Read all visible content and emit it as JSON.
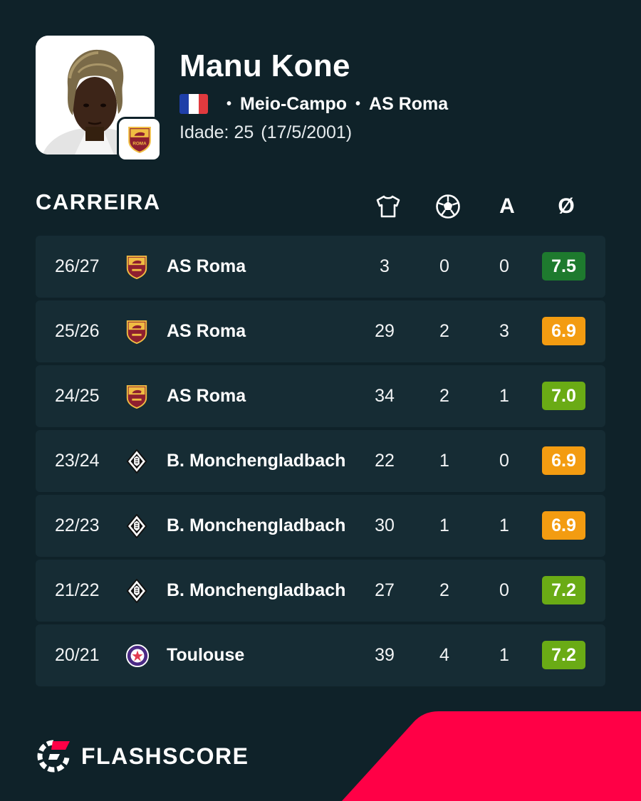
{
  "player": {
    "name": "Manu Kone",
    "nationality_flag": "france-flag",
    "position": "Meio-Campo",
    "club": "AS Roma",
    "age_label": "Idade: 25",
    "birth_date": "(17/5/2001)"
  },
  "career": {
    "title": "CARREIRA",
    "columns": [
      {
        "icon": "shirt-icon",
        "meaning": "appearances"
      },
      {
        "icon": "ball-icon",
        "meaning": "goals"
      },
      {
        "icon": "assists-icon",
        "label": "A"
      },
      {
        "icon": "average-rating-icon",
        "label": "Ø"
      }
    ],
    "rows": [
      {
        "season": "26/27",
        "club": "AS Roma",
        "club_logo": "roma-logo-icon",
        "apps": "3",
        "goals": "0",
        "assists": "0",
        "rating": "7.5",
        "rating_color": "#1e7a2e"
      },
      {
        "season": "25/26",
        "club": "AS Roma",
        "club_logo": "roma-logo-icon",
        "apps": "29",
        "goals": "2",
        "assists": "3",
        "rating": "6.9",
        "rating_color": "#f39c11"
      },
      {
        "season": "24/25",
        "club": "AS Roma",
        "club_logo": "roma-logo-icon",
        "apps": "34",
        "goals": "2",
        "assists": "1",
        "rating": "7.0",
        "rating_color": "#6aab15"
      },
      {
        "season": "23/24",
        "club": "B. Monchengladbach",
        "club_logo": "gladbach-logo-icon",
        "apps": "22",
        "goals": "1",
        "assists": "0",
        "rating": "6.9",
        "rating_color": "#f39c11"
      },
      {
        "season": "22/23",
        "club": "B. Monchengladbach",
        "club_logo": "gladbach-logo-icon",
        "apps": "30",
        "goals": "1",
        "assists": "1",
        "rating": "6.9",
        "rating_color": "#f39c11"
      },
      {
        "season": "21/22",
        "club": "B. Monchengladbach",
        "club_logo": "gladbach-logo-icon",
        "apps": "27",
        "goals": "2",
        "assists": "0",
        "rating": "7.2",
        "rating_color": "#6aab15"
      },
      {
        "season": "20/21",
        "club": "Toulouse",
        "club_logo": "toulouse-logo-icon",
        "apps": "39",
        "goals": "4",
        "assists": "1",
        "rating": "7.2",
        "rating_color": "#6aab15"
      }
    ]
  },
  "brand": {
    "name": "FLASHSCORE",
    "accent_color": "#ff0046"
  },
  "colors": {
    "background": "#0f2229",
    "row_background": "#162c34"
  }
}
